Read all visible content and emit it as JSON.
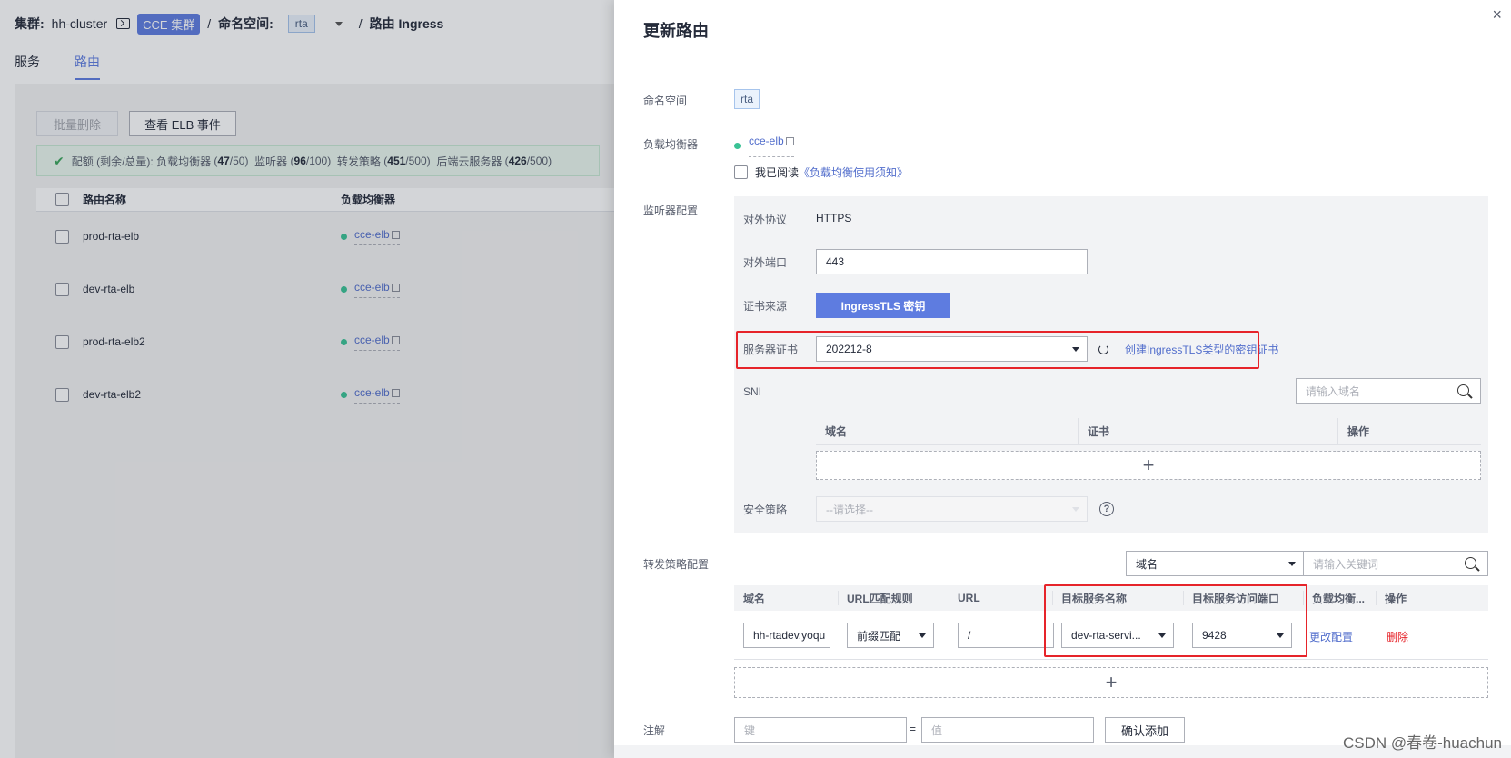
{
  "header": {
    "cluster_label": "集群:",
    "cluster_name": "hh-cluster",
    "cluster_type_badge": "CCE 集群",
    "separator": "/",
    "namespace_label": "命名空间:",
    "namespace_value": "rta",
    "page_title": "路由 Ingress"
  },
  "tabs": [
    {
      "label": "服务",
      "active": false
    },
    {
      "label": "路由",
      "active": true
    }
  ],
  "toolbar": {
    "batch_delete": "批量删除",
    "view_elb_events": "查看 ELB 事件"
  },
  "quota": {
    "prefix": "配额 (剩余/总量):",
    "lb_label": "负载均衡器",
    "lb_used": "47",
    "lb_total": "/50",
    "listener_label": "监听器",
    "listener_used": "96",
    "listener_total": "/100",
    "policy_label": "转发策略",
    "policy_used": "451",
    "policy_total": "/500",
    "backend_label": "后端云服务器",
    "backend_used": "426",
    "backend_total": "/500"
  },
  "ingress_table": {
    "columns": [
      "路由名称",
      "负载均衡器"
    ],
    "rows": [
      {
        "name": "prod-rta-elb",
        "elb": "cce-elb"
      },
      {
        "name": "dev-rta-elb",
        "elb": "cce-elb"
      },
      {
        "name": "prod-rta-elb2",
        "elb": "cce-elb"
      },
      {
        "name": "dev-rta-elb2",
        "elb": "cce-elb"
      }
    ]
  },
  "drawer": {
    "title": "更新路由",
    "close_icon": "×",
    "namespace_label": "命名空间",
    "namespace_value": "rta",
    "lb_label": "负载均衡器",
    "lb_value": "cce-elb",
    "agree_text": "我已阅读",
    "agree_link": "《负载均衡使用须知》",
    "listener_section_label": "监听器配置",
    "listener": {
      "protocol_label": "对外协议",
      "protocol_value": "HTTPS",
      "port_label": "对外端口",
      "port_value": "443",
      "cert_source_label": "证书来源",
      "cert_source_value": "IngressTLS 密钥",
      "server_cert_label": "服务器证书",
      "server_cert_value": "202212-8",
      "create_cert_link": "创建IngressTLS类型的密钥证书",
      "sni_label": "SNI",
      "sni_search_placeholder": "请输入域名",
      "sni_columns": [
        "域名",
        "证书",
        "操作"
      ],
      "add_symbol": "+",
      "security_policy_label": "安全策略",
      "security_policy_placeholder": "--请选择--",
      "help_symbol": "?"
    },
    "forwarding": {
      "section_label": "转发策略配置",
      "filter_field": "域名",
      "keyword_placeholder": "请输入关键词",
      "columns": [
        "域名",
        "URL匹配规则",
        "URL",
        "目标服务名称",
        "目标服务访问端口",
        "负载均衡...",
        "操作"
      ],
      "row": {
        "domain": "hh-rtadev.yoqu",
        "match_rule": "前缀匹配",
        "url": "/",
        "service": "dev-rta-servi...",
        "port": "9428",
        "edit": "更改配置",
        "delete": "删除"
      },
      "add_symbol": "+"
    },
    "annotation": {
      "label": "注解",
      "key_placeholder": "键",
      "eq": "=",
      "value_placeholder": "值",
      "confirm": "确认添加"
    }
  },
  "watermark": "CSDN @春卷-huachun",
  "colors": {
    "primary": "#5e7ce0",
    "link": "#526ecc",
    "danger": "#e6242a",
    "success": "#3ac295",
    "highlight": "#e6242a"
  }
}
